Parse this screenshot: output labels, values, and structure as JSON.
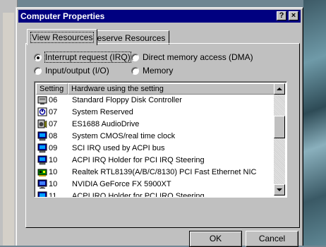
{
  "window": {
    "title": "Computer Properties",
    "help_label": "?",
    "close_label": "×"
  },
  "tabs": [
    {
      "label": "View Resources",
      "active": true
    },
    {
      "label": "Reserve Resources",
      "active": false
    }
  ],
  "radios": [
    {
      "label": "Interrupt request (IRQ)",
      "checked": true
    },
    {
      "label": "Direct memory access (DMA)",
      "checked": false
    },
    {
      "label": "Input/output (I/O)",
      "checked": false
    },
    {
      "label": "Memory",
      "checked": false
    }
  ],
  "list": {
    "columns": {
      "setting": "Setting",
      "hardware": "Hardware using the setting"
    },
    "rows": [
      {
        "setting": "06",
        "hardware": "Standard Floppy Disk Controller",
        "icon": "floppy-controller-icon"
      },
      {
        "setting": "07",
        "hardware": "System Reserved",
        "icon": "system-reserved-icon"
      },
      {
        "setting": "07",
        "hardware": "ES1688 AudioDrive",
        "icon": "sound-device-icon"
      },
      {
        "setting": "08",
        "hardware": "System CMOS/real time clock",
        "icon": "system-device-icon"
      },
      {
        "setting": "09",
        "hardware": "SCI IRQ used by ACPI bus",
        "icon": "system-device-icon"
      },
      {
        "setting": "10",
        "hardware": "ACPI IRQ Holder for PCI IRQ Steering",
        "icon": "system-device-icon"
      },
      {
        "setting": "10",
        "hardware": "Realtek RTL8139(A/B/C/8130) PCI Fast Ethernet NIC",
        "icon": "network-adapter-icon"
      },
      {
        "setting": "10",
        "hardware": "NVIDIA GeForce FX 5900XT",
        "icon": "display-adapter-icon"
      },
      {
        "setting": "11",
        "hardware": "ACPI IRQ Holder for PCI IRQ Steering",
        "icon": "system-device-icon"
      }
    ],
    "scroll_position": 0.32
  },
  "buttons": {
    "ok": "OK",
    "cancel": "Cancel"
  },
  "colors": {
    "titlebar": "#000080",
    "face": "#c0c0c0"
  }
}
